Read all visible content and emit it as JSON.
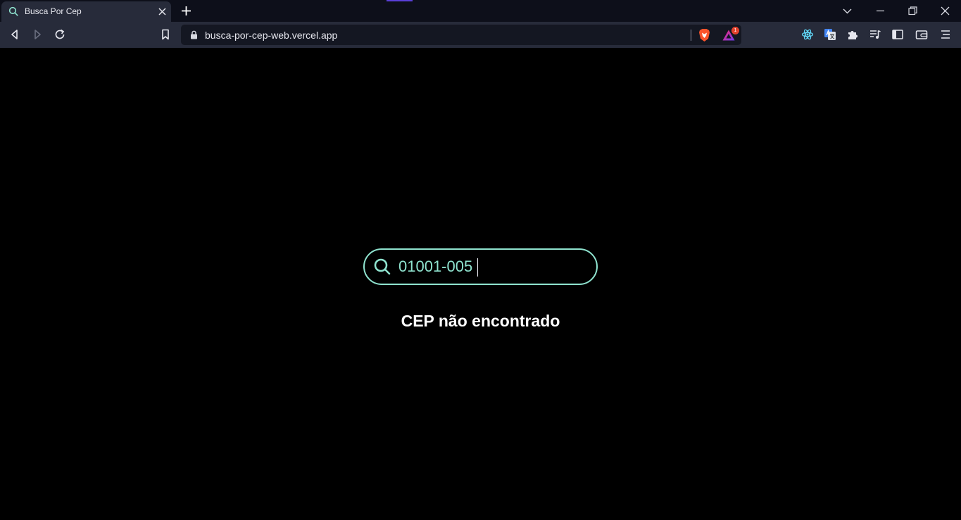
{
  "browser": {
    "tab": {
      "title": "Busca Por Cep",
      "favicon": "search-icon"
    },
    "url": "busca-por-cep-web.vercel.app",
    "rewards_badge": "1"
  },
  "colors": {
    "accent": "#8fe3cf",
    "page_background": "#000000",
    "toolbar": "#272b3a"
  },
  "search": {
    "value": "01001-005",
    "icon": "search-icon"
  },
  "result": {
    "message": "CEP não encontrado"
  }
}
